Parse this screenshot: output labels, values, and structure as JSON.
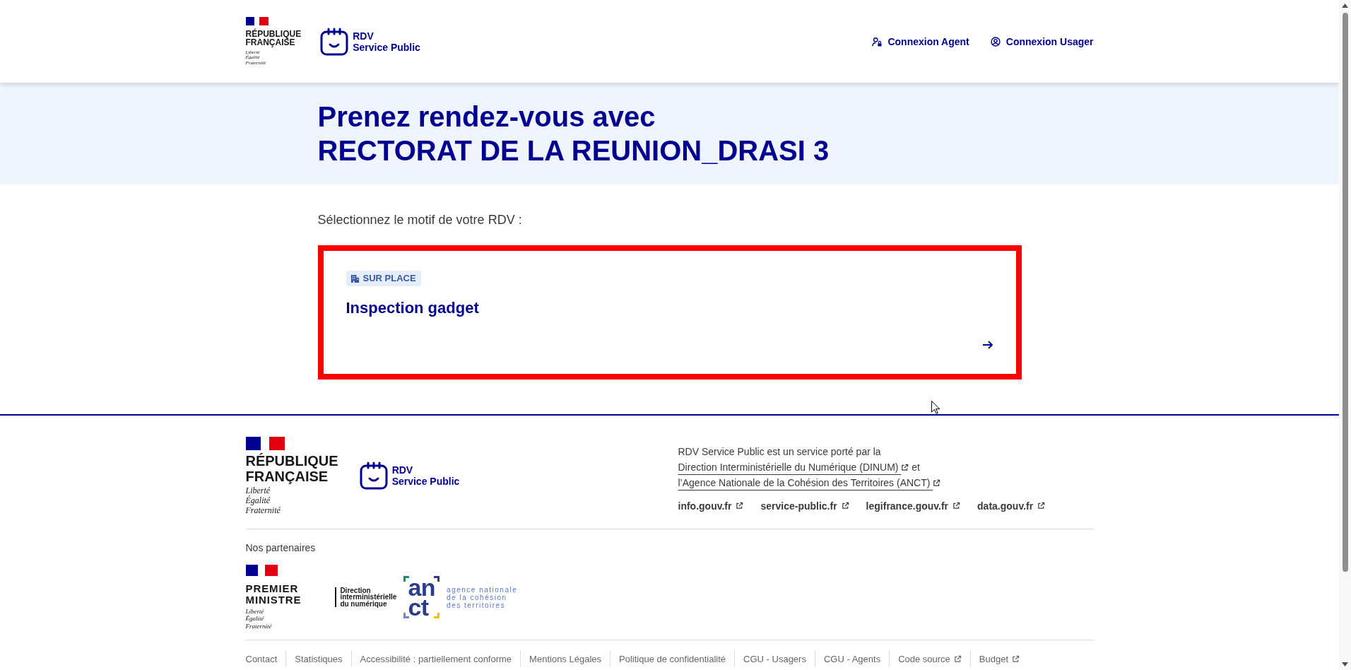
{
  "header": {
    "brand": {
      "country": "RÉPUBLIQUE\nFRANÇAISE",
      "motto": "Liberté\nÉgalité\nFraternité"
    },
    "service_name": "RDV\nService Public",
    "links": [
      {
        "kind": "agent",
        "label": "Connexion Agent"
      },
      {
        "kind": "user",
        "label": "Connexion Usager"
      }
    ]
  },
  "hero": {
    "title": "Prenez rendez-vous avec\nRECTORAT DE LA REUNION_DRASI 3"
  },
  "main": {
    "prompt": "Sélectionnez le motif de votre RDV :",
    "motifs": [
      {
        "location": "SUR PLACE",
        "title": "Inspection gadget",
        "highlighted": true
      }
    ]
  },
  "footer": {
    "brand": {
      "country": "RÉPUBLIQUE\nFRANÇAISE",
      "motto": "Liberté\nÉgalité\nFraternité"
    },
    "service_name": "RDV\nService Public",
    "description": [
      {
        "kind": "text",
        "text": "RDV Service Public est un service porté par la"
      },
      {
        "kind": "link",
        "text": "Direction Interministérielle du Numérique (DINUM)",
        "external": true
      },
      {
        "kind": "text",
        "text": "et"
      },
      {
        "kind": "link",
        "text": "l’Agence Nationale de la Cohésion des Territoires (ANCT)",
        "external": true
      }
    ],
    "site_links": [
      {
        "label": "info.gouv.fr",
        "external": true
      },
      {
        "label": "service-public.fr",
        "external": true
      },
      {
        "label": "legifrance.gouv.fr",
        "external": true
      },
      {
        "label": "data.gouv.fr",
        "external": true
      }
    ],
    "partners": {
      "title": "Nos partenaires",
      "logos": [
        {
          "kind": "government",
          "name": "PREMIER\nMINISTRE",
          "motto": "Liberté\nÉgalité\nFraternité"
        },
        {
          "kind": "dinum",
          "name": "Direction\ninterministérielle\ndu numérique"
        },
        {
          "kind": "anct",
          "mark": "an\nct",
          "name": "agence nationale\nde la cohésion\ndes territoires"
        }
      ]
    },
    "bottom_links": [
      {
        "label": "Contact",
        "external": false
      },
      {
        "label": "Statistiques",
        "external": false
      },
      {
        "label": "Accessibilité : partiellement conforme",
        "external": false
      },
      {
        "label": "Mentions Légales",
        "external": false
      },
      {
        "label": "Politique de confidentialité",
        "external": false
      },
      {
        "label": "CGU - Usagers",
        "external": false
      },
      {
        "label": "CGU - Agents",
        "external": false
      },
      {
        "label": "Code source",
        "external": true
      },
      {
        "label": "Budget",
        "external": true
      }
    ]
  }
}
